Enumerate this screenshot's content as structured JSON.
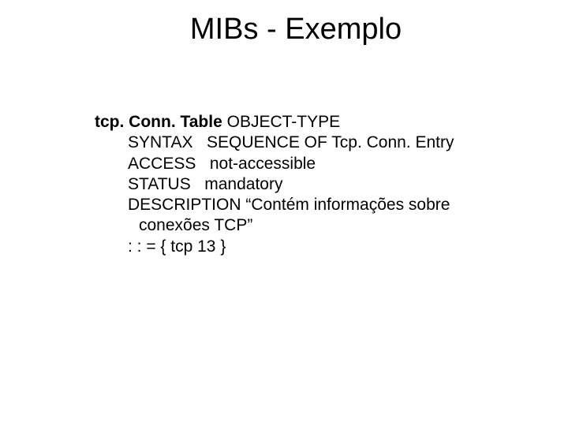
{
  "title": "MIBs - Exemplo",
  "def": {
    "header_name": "tcp. Conn. Table ",
    "header_rest": "OBJECT-TYPE",
    "syntax": "SYNTAX   SEQUENCE OF Tcp. Conn. Entry",
    "access": "ACCESS   not-accessible",
    "status": "STATUS   mandatory",
    "desc1": "DESCRIPTION “Contém informações sobre",
    "desc2": "conexões TCP”",
    "assign": ": : = { tcp 13 }"
  }
}
